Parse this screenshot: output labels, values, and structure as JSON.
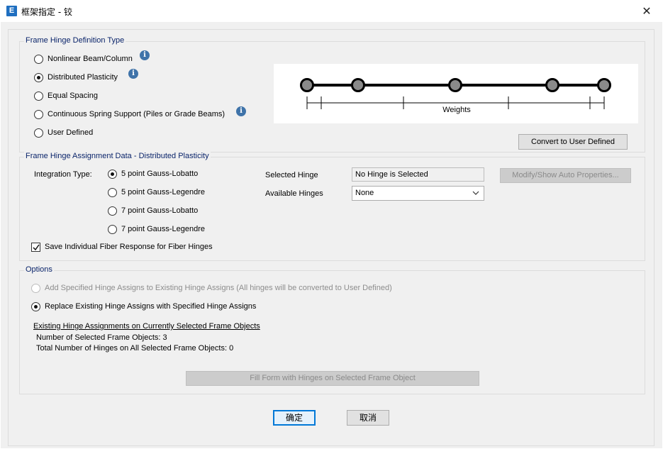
{
  "window": {
    "icon_letter": "E",
    "title": "框架指定 - 铰",
    "close_glyph": "✕"
  },
  "definition_type": {
    "title": "Frame Hinge Definition Type",
    "options": [
      {
        "label": "Nonlinear Beam/Column",
        "checked": false,
        "info": true
      },
      {
        "label": "Distributed Plasticity",
        "checked": true,
        "info": true
      },
      {
        "label": "Equal Spacing",
        "checked": false,
        "info": false
      },
      {
        "label": "Continuous Spring Support (Piles or Grade Beams)",
        "checked": false,
        "info": true
      },
      {
        "label": "User Defined",
        "checked": false,
        "info": false
      }
    ],
    "diagram_caption": "Weights",
    "convert_button": "Convert to User Defined"
  },
  "assignment_data": {
    "title": "Frame Hinge Assignment Data - Distributed Plasticity",
    "integration_type_label": "Integration Type:",
    "integration_options": [
      {
        "label": "5 point Gauss-Lobatto",
        "checked": true
      },
      {
        "label": "5 point Gauss-Legendre",
        "checked": false
      },
      {
        "label": "7 point Gauss-Lobatto",
        "checked": false
      },
      {
        "label": "7 point Gauss-Legendre",
        "checked": false
      }
    ],
    "selected_hinge_label": "Selected Hinge",
    "selected_hinge_value": "No Hinge is Selected",
    "available_hinges_label": "Available Hinges",
    "available_hinges_value": "None",
    "modify_button": "Modify/Show Auto Properties...",
    "save_fiber_label": "Save Individual Fiber Response for Fiber Hinges",
    "save_fiber_checked": true
  },
  "options": {
    "title": "Options",
    "add_label": "Add Specified Hinge Assigns to Existing Hinge Assigns (All hinges will be converted to User Defined)",
    "replace_label": "Replace Existing Hinge Assigns with Specified Hinge Assigns",
    "existing_heading": "Existing Hinge Assignments on Currently Selected Frame Objects",
    "num_selected": "Number of Selected Frame Objects: 3",
    "total_hinges": "Total Number of Hinges on All Selected Frame Objects: 0",
    "fill_button": "Fill Form with Hinges on Selected Frame Object"
  },
  "footer": {
    "ok": "确定",
    "cancel": "取消"
  },
  "colors": {
    "group_title": "#0a246a",
    "info_icon": "#3f73a9",
    "default_button_border": "#0078d7"
  }
}
